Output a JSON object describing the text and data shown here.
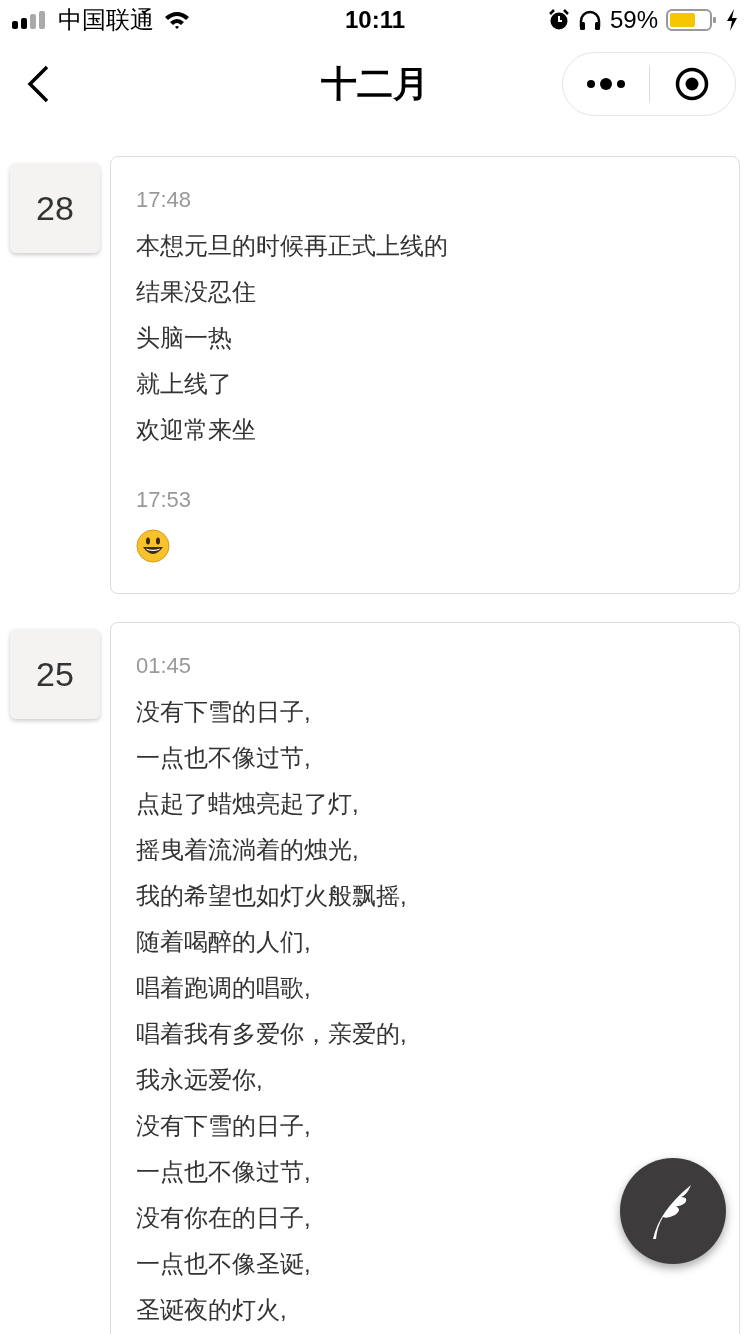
{
  "status_bar": {
    "carrier": "中国联通",
    "time": "10:11",
    "battery": "59%"
  },
  "nav": {
    "title": "十二月"
  },
  "entries": [
    {
      "day": "28",
      "posts": [
        {
          "kind": "text",
          "time": "17:48",
          "lines": [
            "本想元旦的时候再正式上线的",
            "结果没忍住",
            "头脑一热",
            "就上线了",
            "欢迎常来坐"
          ]
        },
        {
          "kind": "emoji",
          "time": "17:53"
        }
      ]
    },
    {
      "day": "25",
      "posts": [
        {
          "kind": "text",
          "time": "01:45",
          "lines": [
            "没有下雪的日子,",
            "一点也不像过节,",
            "点起了蜡烛亮起了灯,",
            "摇曳着流淌着的烛光,",
            "我的希望也如灯火般飘摇,",
            "随着喝醉的人们,",
            "唱着跑调的唱歌,",
            "唱着我有多爱你，亲爱的,",
            "我永远爱你,",
            "没有下雪的日子,",
            "一点也不像过节,",
            "没有你在的日子,",
            "一点也不像圣诞,",
            "圣诞夜的灯火,"
          ]
        }
      ]
    }
  ]
}
